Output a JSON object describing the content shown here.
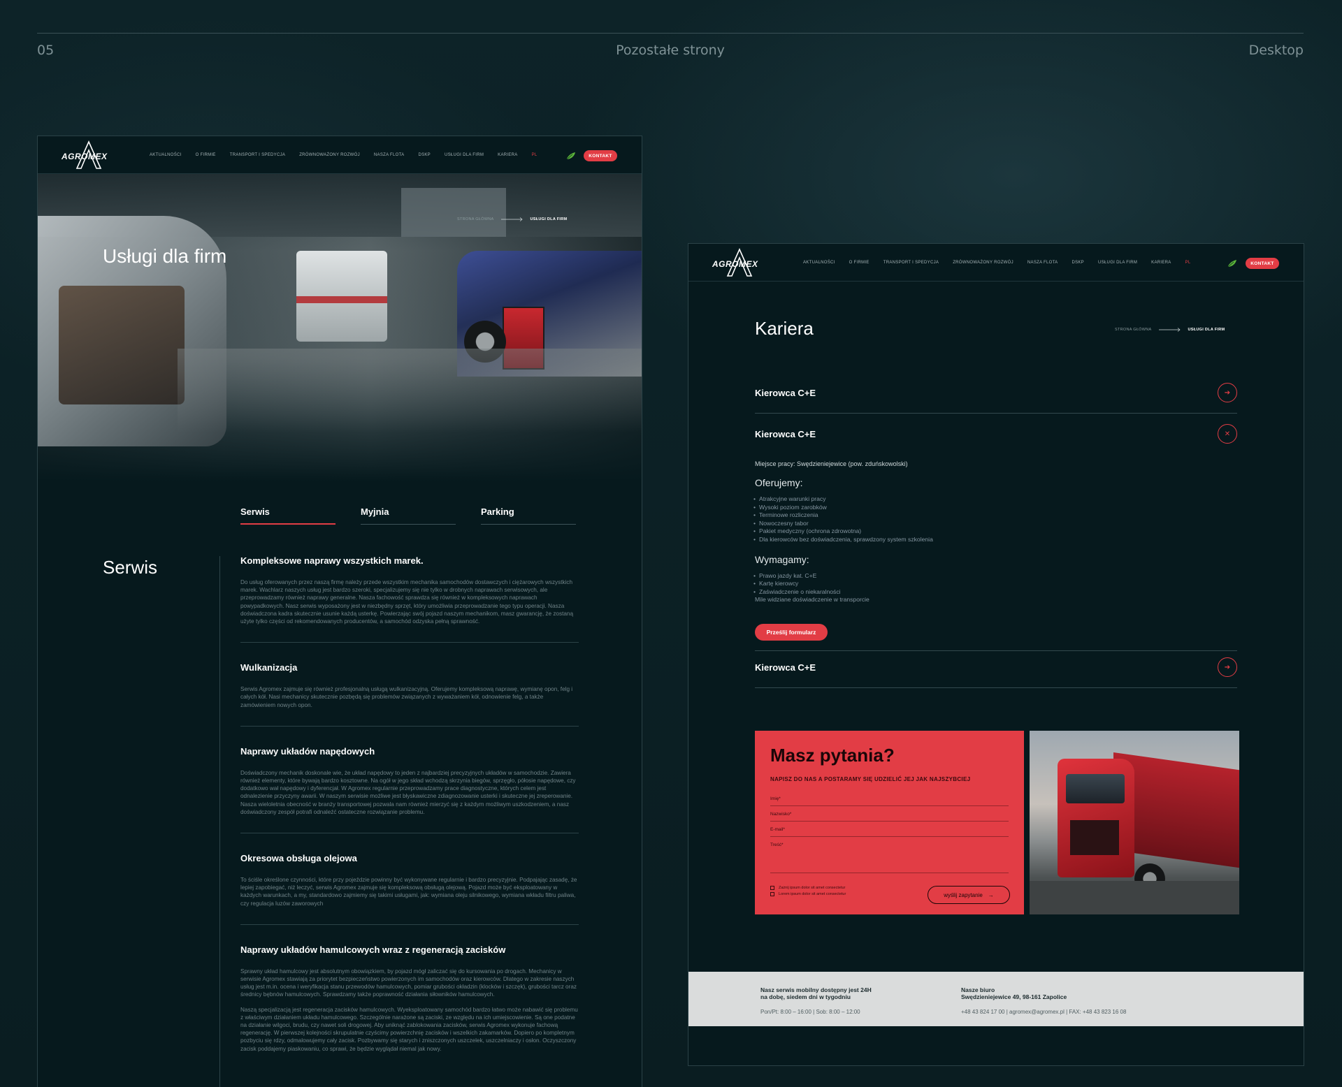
{
  "header": {
    "number": "05",
    "title": "Pozostałe strony",
    "right": "Desktop"
  },
  "nav": {
    "logo": "AGROMEX",
    "items": [
      "AKTUALNOŚCI",
      "O FIRMIE",
      "TRANSPORT I SPEDYCJA",
      "ZRÓWNOWAŻONY ROZWÓJ",
      "NASZA FLOTA",
      "DSKP",
      "USŁUGI DLA FIRM",
      "KARIERA"
    ],
    "lang": "PL",
    "contact_button": "KONTAKT"
  },
  "left_page": {
    "hero_title": "Usługi dla firm",
    "breadcrumb_home": "STRONA GŁÓWNA",
    "breadcrumb_current": "USŁUGI DLA FIRM",
    "tabs": [
      "Serwis",
      "Myjnia",
      "Parking"
    ],
    "section_title": "Serwis",
    "services": [
      {
        "title": "Kompleksowe naprawy wszystkich marek.",
        "text": "Do usług oferowanych przez naszą firmę należy przede wszystkim mechanika samochodów dostawczych i ciężarowych wszystkich marek. Wachlarz naszych usług jest bardzo szeroki, specjalizujemy się nie tylko w drobnych naprawach serwisowych, ale przeprowadzamy również naprawy generalne. Nasza fachowość sprawdza się również w kompleksowych naprawach powypadkowych. Nasz serwis wyposażony jest w niezbędny sprzęt, który umożliwia przeprowadzanie tego typu operacji. Nasza doświadczona kadra skutecznie usunie każdą usterkę. Powierzając swój pojazd naszym mechanikom, masz gwarancję, że zostaną użyte tylko części od rekomendowanych producentów, a samochód odzyska pełną sprawność."
      },
      {
        "title": "Wulkanizacja",
        "text": "Serwis Agromex zajmuje się również profesjonalną usługą wulkanizacyjną. Oferujemy kompleksową naprawę, wymianę opon, felg i całych kół. Nasi mechanicy skutecznie pozbędą się problemów związanych z wyważaniem kół, odnowienie felg, a także zamówieniem nowych opon."
      },
      {
        "title": "Naprawy układów napędowych",
        "text": "Doświadczony mechanik doskonale wie, że układ napędowy to jeden z najbardziej precyzyjnych układów w samochodzie. Zawiera również elementy, które bywają bardzo kosztowne. Na ogół w jego skład wchodzą skrzynia biegów, sprzęgło, półosie napędowe, czy dodatkowo wał napędowy i dyferencjał. W Agromex regularnie przeprowadzamy prace diagnostyczne, których celem jest odnalezienie przyczyny awarii. W naszym serwisie możliwe jest błyskawiczne zdiagnozowanie usterki i skuteczne jej zreperowanie. Nasza wieloletnia obecność w branży transportowej pozwala nam również mierzyć się z każdym możliwym uszkodzeniem, a nasz doświadczony zespół potrafi odnaleźć ostateczne rozwiązanie problemu."
      },
      {
        "title": "Okresowa obsługa olejowa",
        "text": "To ściśle określone czynności, które przy pojeździe powinny być wykonywane regularnie i bardzo precyzyjnie. Podpajając zasadę, że lepiej zapobiegać, niż leczyć, serwis Agromex zajmuje się kompleksową obsługą olejową. Pojazd może być eksploatowany w każdych warunkach, a my, standardowo zajmiemy się takimi usługami, jak: wymiana oleju silnikowego, wymiana wkładu filtru paliwa, czy regulacja luzów zaworowych"
      },
      {
        "title": "Naprawy układów hamulcowych wraz z regeneracją zacisków",
        "text": "Sprawny układ hamulcowy jest absolutnym obowiązkiem, by pojazd mógł zaliczać się do kursowania po drogach. Mechanicy w serwisie Agromex stawiają za priorytet bezpieczeństwo powierzonych im samochodów oraz kierowców. Dlatego w zakresie naszych usług jest m.in. ocena i weryfikacja stanu przewodów hamulcowych, pomiar grubości okładzin (klocków i szczęk), grubości tarcz oraz średnicy bębnów hamulcowych. Sprawdzamy także poprawność działania siłowników hamulcowych.",
        "text2": "Naszą specjalizacją jest regeneracja zacisków hamulcowych. Wyeksploatowany samochód bardzo łatwo może nabawić się problemu z właściwym działaniem układu hamulcowego. Szczególnie narażone są zaciski, ze względu na ich umiejscowienie. Są one podatne na działanie wilgoci, brudu, czy nawet soli drogowej. Aby uniknąć zablokowania zacisków, serwis Agromex wykonuje fachową regenerację. W pierwszej kolejności skrupulatnie czyścimy powierzchnię zacisków i wszelkich zakamarków. Dopiero po kompletnym pozbyciu się rdzy, odmalowujemy cały zacisk. Pozbywamy się starych i zniszczonych uszczelek, uszczelniaczy i osłon. Oczyszczony zacisk poddajemy piaskowaniu, co sprawi, że będzie wyglądał niemal jak nowy."
      }
    ]
  },
  "right_page": {
    "page_title": "Kariera",
    "breadcrumb_home": "STRONA GŁÓWNA",
    "breadcrumb_current": "USŁUGI DLA FIRM",
    "jobs": [
      {
        "title": "Kierowca C+E",
        "icon": "arrow-right-icon"
      },
      {
        "title": "Kierowca C+E",
        "icon": "close-icon"
      },
      {
        "title": "Kierowca C+E",
        "icon": "arrow-right-icon"
      }
    ],
    "job_details": {
      "location": "Miejsce pracy: Swędzieniejewice (pow. zduńskowolski)",
      "offer_heading": "Oferujemy:",
      "offer": [
        "Atrakcyjne warunki pracy",
        "Wysoki poziom zarobków",
        "Terminowe rozliczenia",
        "Nowoczesny tabor",
        "Pakiet medyczny (ochrona zdrowotna)",
        "Dla kierowców bez doświadczenia, sprawdzony system szkolenia"
      ],
      "req_heading": "Wymagamy:",
      "requirements": [
        "Prawo jazdy kat. C+E",
        "Kartę kierowcy",
        "Zaświadczenie o niekaralności"
      ],
      "note": "Mile widziane doświadczenie w transporcie",
      "submit": "Prześlij formularz"
    },
    "contact": {
      "title": "Masz pytania?",
      "subtitle": "NAPISZ DO NAS A POSTARAMY SIĘ UDZIELIĆ JEJ JAK NAJSZYBCIEJ",
      "fields": [
        "Imię*",
        "Nazwisko*",
        "E-mail*",
        "Treść*"
      ],
      "consents": [
        "Zażnij ipsum dolor sit amet consectetur",
        "Lorem ipsum dolor sit amet consectetur"
      ],
      "send": "wyślij zapytanie"
    },
    "footer": {
      "service_heading_1": "Nasz serwis mobilny dostępny jest 24H",
      "service_heading_2": "na dobę, siedem dni w tygodniu",
      "service_hours": "Pon/Pt: 8:00 – 16:00   |   Sob: 8:00 – 12:00",
      "office_heading_1": "Nasze biuro",
      "office_heading_2": "Swędzieniejewice 49, 98-161 Zapolice",
      "office_details": "+48 43 824 17 00  |  agromex@agromex.pl  |  FAX: +48 43 823 16 08"
    }
  },
  "colors": {
    "background": "#0c2126",
    "accent": "#e23d45",
    "footer": "#dadcdc"
  }
}
